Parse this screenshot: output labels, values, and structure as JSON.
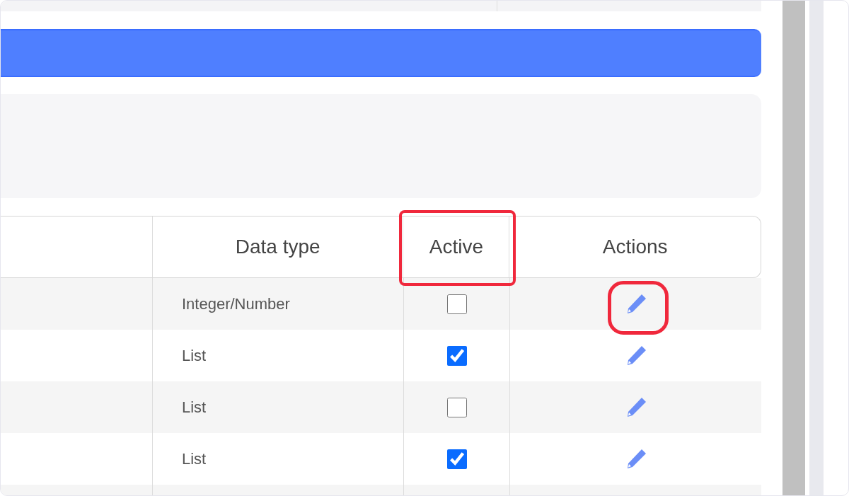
{
  "table": {
    "columns": [
      {
        "label": "Data type",
        "highlighted": false
      },
      {
        "label": "Active",
        "highlighted": true
      },
      {
        "label": "Actions",
        "highlighted": false
      }
    ],
    "rows": [
      {
        "data_type": "Integer/Number",
        "active": false,
        "edit_highlighted": true
      },
      {
        "data_type": "List",
        "active": true,
        "edit_highlighted": false
      },
      {
        "data_type": "List",
        "active": false,
        "edit_highlighted": false
      },
      {
        "data_type": "List",
        "active": true,
        "edit_highlighted": false
      }
    ]
  }
}
